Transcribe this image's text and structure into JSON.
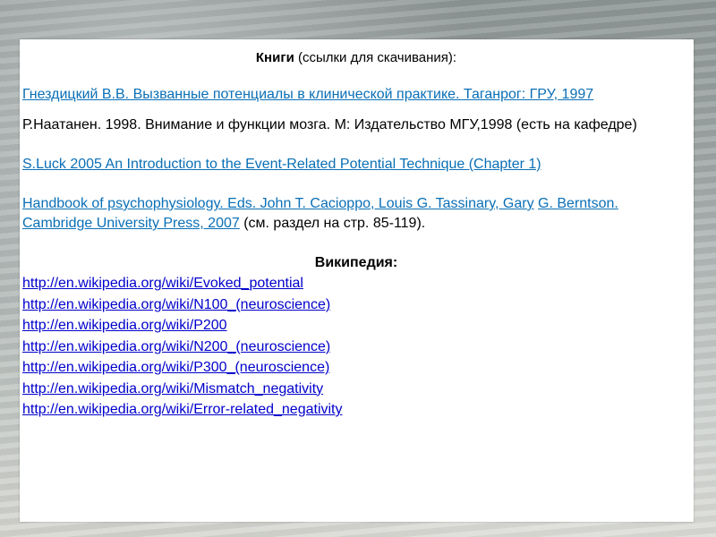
{
  "heading": {
    "bold": "Книги",
    "rest": " (ссылки для скачивания):"
  },
  "ref1": {
    "link": "Гнездицкий В.В. Вызванные потенциалы в клинической практике. Таганрог: ГРУ, 1997"
  },
  "ref2": {
    "text": "Р.Наатанен. 1998. Внимание и функции мозга. М: Издательство МГУ,1998 (есть на кафедре)"
  },
  "ref3": {
    "link": "S.Luck 2005 An Introduction to the Event-Related Potential Technique (Chapter 1)"
  },
  "ref4": {
    "link_a": "Handbook of psychophysiology. Eds. John T. Cacioppo, Louis G. Tassinary, Gary",
    "link_b": "G. Berntson. Cambridge University Press, 2007",
    "tail": " (см.  раздел на стр. 85-119)."
  },
  "wiki_heading": "Википедия:",
  "wiki_links": [
    "http://en.wikipedia.org/wiki/Evoked_potential",
    "http://en.wikipedia.org/wiki/N100_(neuroscience)",
    "http://en.wikipedia.org/wiki/P200",
    "http://en.wikipedia.org/wiki/N200_(neuroscience)",
    "http://en.wikipedia.org/wiki/P300_(neuroscience)",
    "http://en.wikipedia.org/wiki/Mismatch_negativity",
    "http://en.wikipedia.org/wiki/Error-related_negativity"
  ],
  "colors": {
    "link_primary": "#0a6fb6",
    "link_wiki": "#0000cc",
    "card_bg": "#ffffff"
  }
}
